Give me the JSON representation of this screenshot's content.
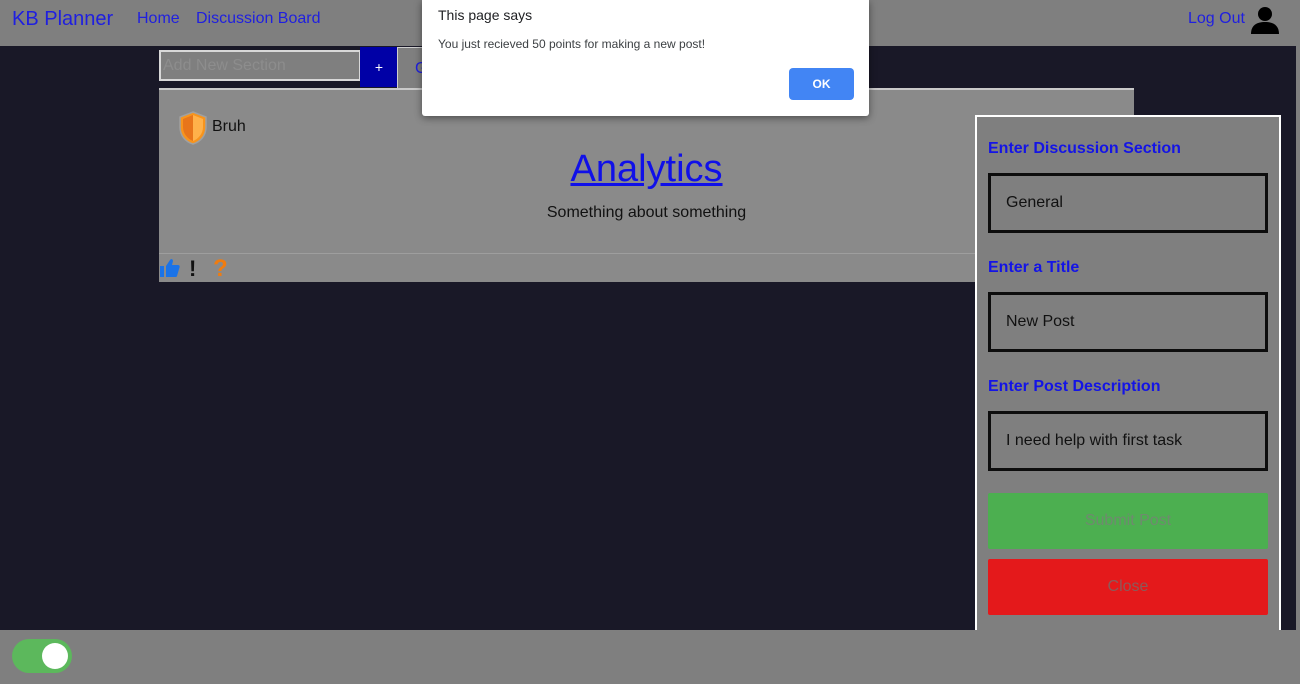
{
  "navbar": {
    "brand": "KB Planner",
    "links": [
      "Home",
      "Discussion Board"
    ],
    "logout_label": "Log Out",
    "user_icon": "user-icon"
  },
  "sections": {
    "add_placeholder": "Add New Section",
    "add_button_label": "+",
    "tabs": [
      "General"
    ]
  },
  "post": {
    "author": "Bruh",
    "badge_icon": "shield-icon",
    "title": "Analytics",
    "description": "Something about something",
    "actions": [
      {
        "icon": "thumbs-up-icon"
      },
      {
        "icon": "exclamation-icon",
        "glyph": "!"
      },
      {
        "icon": "question-icon",
        "glyph": "?"
      }
    ]
  },
  "dialog": {
    "title": "This page says",
    "message": "You just recieved 50 points for making a new post!",
    "ok_label": "OK"
  },
  "form": {
    "section_label": "Enter Discussion Section",
    "section_value": "General",
    "title_label": "Enter a Title",
    "title_value": "New Post",
    "description_label": "Enter Post Description",
    "description_value": "I need help with first task",
    "submit_label": "Submit Post",
    "close_label": "Close"
  },
  "footer": {
    "theme_toggle_on": true
  },
  "colors": {
    "link": "#1f1fe0",
    "background": "#191827",
    "surface": "#7f7f7f",
    "submit": "#4caf50",
    "close": "#e4191b",
    "dialog_ok": "#4285f4",
    "toggle_on": "#5cb85c"
  }
}
